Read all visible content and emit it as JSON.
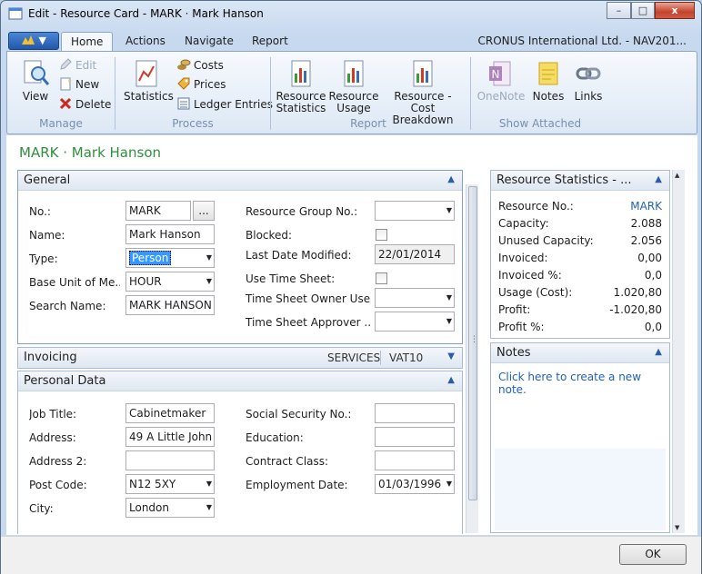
{
  "window": {
    "title": "Edit - Resource Card - MARK · Mark Hanson",
    "min": "–",
    "max": "□",
    "close": "x"
  },
  "ribbon": {
    "app_button": "▼",
    "tabs": [
      "Home",
      "Actions",
      "Navigate",
      "Report"
    ],
    "company": "CRONUS International Ltd. - NAV201...",
    "manage": {
      "label": "Manage",
      "view": "View",
      "edit": "Edit",
      "new": "New",
      "delete": "Delete"
    },
    "process": {
      "label": "Process",
      "statistics": "Statistics",
      "costs": "Costs",
      "prices": "Prices",
      "ledger": "Ledger Entries"
    },
    "report": {
      "label": "Report",
      "res_stat_1": "Resource",
      "res_stat_2": "Statistics",
      "res_usage_1": "Resource",
      "res_usage_2": "Usage",
      "cost_1": "Resource - Cost",
      "cost_2": "Breakdown"
    },
    "show_attached": {
      "label": "Show Attached",
      "onenote": "OneNote",
      "notes": "Notes",
      "links": "Links"
    }
  },
  "page_title": "MARK · Mark Hanson",
  "general": {
    "title": "General",
    "no_label": "No.:",
    "no_value": "MARK",
    "no_btn": "...",
    "name_label": "Name:",
    "name_value": "Mark Hanson",
    "type_label": "Type:",
    "type_value": "Person",
    "uom_label": "Base Unit of Me...",
    "uom_value": "HOUR",
    "search_label": "Search Name:",
    "search_value": "MARK HANSON",
    "group_label": "Resource Group No.:",
    "group_value": "",
    "blocked_label": "Blocked:",
    "lastmod_label": "Last Date Modified:",
    "lastmod_value": "22/01/2014",
    "timesheet_label": "Use Time Sheet:",
    "owner_label": "Time Sheet Owner Use...",
    "owner_value": "",
    "approver_label": "Time Sheet Approver ...",
    "approver_value": ""
  },
  "invoicing": {
    "title": "Invoicing",
    "tag1": "SERVICES",
    "tag2": "VAT10"
  },
  "personal": {
    "title": "Personal Data",
    "job_label": "Job Title:",
    "job_value": "Cabinetmaker",
    "addr_label": "Address:",
    "addr_value": "49 A Little John ...",
    "addr2_label": "Address 2:",
    "addr2_value": "",
    "post_label": "Post Code:",
    "post_value": "N12 5XY",
    "city_label": "City:",
    "city_value": "London",
    "ssn_label": "Social Security No.:",
    "ssn_value": "",
    "edu_label": "Education:",
    "edu_value": "",
    "contract_label": "Contract Class:",
    "contract_value": "",
    "emp_label": "Employment Date:",
    "emp_value": "01/03/1996"
  },
  "stats": {
    "title": "Resource Statistics - ...",
    "rows": [
      {
        "k": "Resource No.:",
        "v": "MARK"
      },
      {
        "k": "Capacity:",
        "v": "2.088"
      },
      {
        "k": "Unused Capacity:",
        "v": "2.056"
      },
      {
        "k": "Invoiced:",
        "v": "0,00"
      },
      {
        "k": "Invoiced %:",
        "v": "0,0"
      },
      {
        "k": "Usage (Cost):",
        "v": "1.020,80"
      },
      {
        "k": "Profit:",
        "v": "-1.020,80"
      },
      {
        "k": "Profit %:",
        "v": "0,0"
      }
    ]
  },
  "notes": {
    "title": "Notes",
    "link": "Click here to create a new note."
  },
  "footer": {
    "ok": "OK"
  },
  "colors": {
    "accent": "#2f8f3c",
    "link": "#1f62b4",
    "ribbon_bg": "#dde8f5"
  }
}
